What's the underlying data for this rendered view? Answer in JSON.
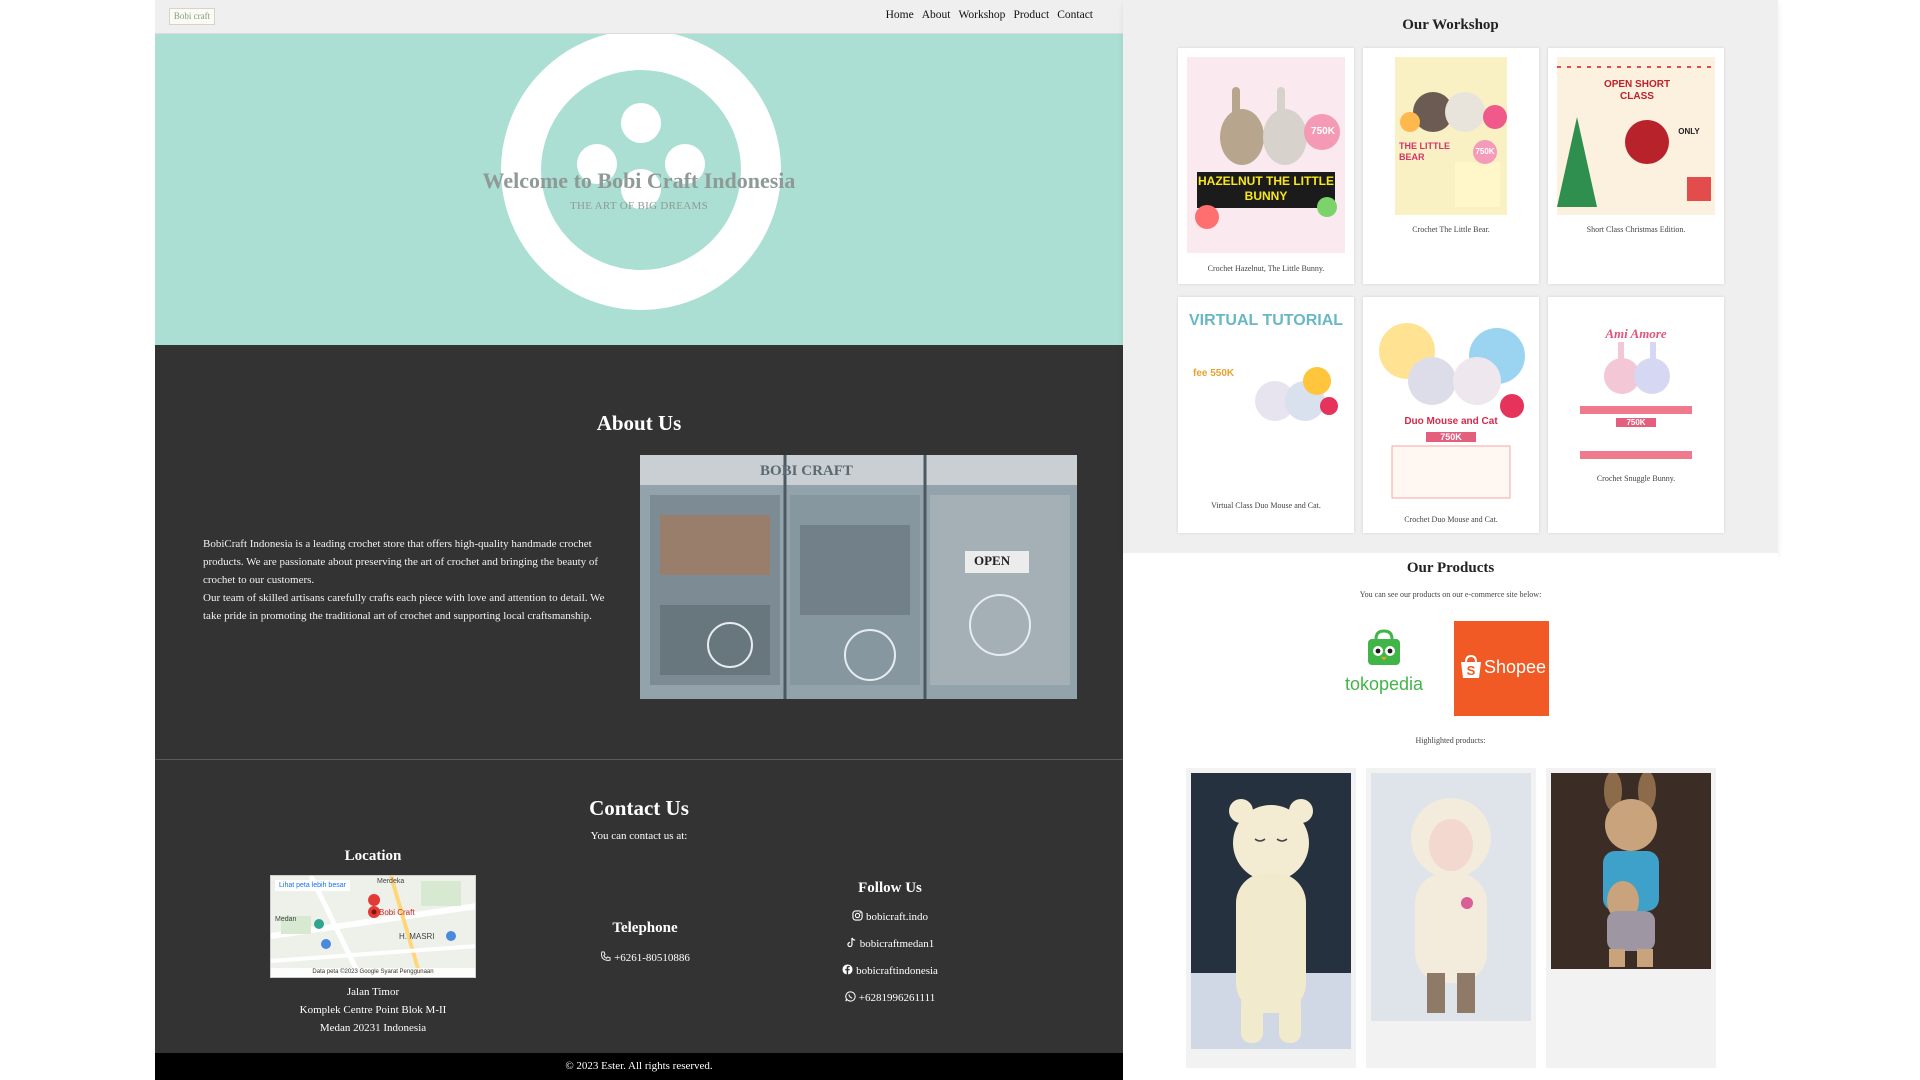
{
  "navbar": {
    "logo_text": "Bobi craft",
    "links": [
      "Home",
      "About",
      "Workshop",
      "Product",
      "Contact"
    ]
  },
  "hero": {
    "title": "Welcome to Bobi Craft Indonesia",
    "subtitle": "THE ART OF BIG DREAMS"
  },
  "about": {
    "heading": "About Us",
    "paragraph1": "BobiCraft Indonesia is a leading crochet store that offers high-quality handmade crochet products. We are passionate about preserving the art of crochet and bringing the beauty of crochet to our customers.",
    "paragraph2": "Our team of skilled artisans carefully crafts each piece with love and attention to detail. We take pride in promoting the traditional art of crochet and supporting local craftsmanship.",
    "photo_sign1": "BOBI CRAFT",
    "photo_sign2": "OPEN"
  },
  "contact": {
    "heading": "Contact Us",
    "subtitle": "You can contact us at:",
    "location": {
      "title": "Location",
      "map_link": "Lihat peta lebih besar",
      "map_pin": "Bobi Craft",
      "map_labels": [
        "Merdeka",
        "Medan",
        "H. MASRI"
      ],
      "map_footer": "Data peta ©2023 Google   Syarat Penggunaan",
      "address": [
        "Jalan Timor",
        "Komplek Centre Point Blok M-II",
        "Medan 20231 Indonesia"
      ]
    },
    "telephone": {
      "title": "Telephone",
      "number": "+6261-80510886"
    },
    "follow": {
      "title": "Follow Us",
      "instagram": "bobicraft.indo",
      "tiktok": "bobicraftmedan1",
      "facebook": "bobicraftindonesia",
      "whatsapp": "+6281996261111"
    }
  },
  "footer": {
    "text": "© 2023 Ester. All rights reserved."
  },
  "workshop": {
    "heading": "Our Workshop",
    "items": [
      {
        "caption": "Crochet Hazelnut, The Little Bunny.",
        "poster_title": "HAZELNUT THE LITTLE BUNNY",
        "price": "750K"
      },
      {
        "caption": "Crochet The Little Bear.",
        "poster_title": "THE LITTLE BEAR",
        "price": "750K"
      },
      {
        "caption": "Short Class Christmas Edition.",
        "poster_title": "OPEN SHORT CLASS",
        "price": "ONLY"
      },
      {
        "caption": "Virtual Class Duo Mouse and Cat.",
        "poster_title": "VIRTUAL TUTORIAL",
        "price": "fee 550K"
      },
      {
        "caption": "Crochet Duo Mouse and Cat.",
        "poster_title": "Duo Mouse and Cat",
        "price": "750K"
      },
      {
        "caption": "Crochet Snuggle Bunny.",
        "poster_title": "Ami Amore",
        "price": "750K"
      }
    ]
  },
  "products": {
    "heading": "Our Products",
    "subtitle": "You can see our products on our e-commerce site below:",
    "tokopedia_label": "tokopedia",
    "shopee_label": "Shopee",
    "highlighted_label": "Highlighted products:"
  },
  "colors": {
    "hero_bg": "#acdfd3",
    "dark_bg": "#333333",
    "footer_bg": "#000000",
    "panel_bg": "#efefef",
    "tokopedia_green": "#42b549",
    "shopee_orange": "#f15a24"
  }
}
